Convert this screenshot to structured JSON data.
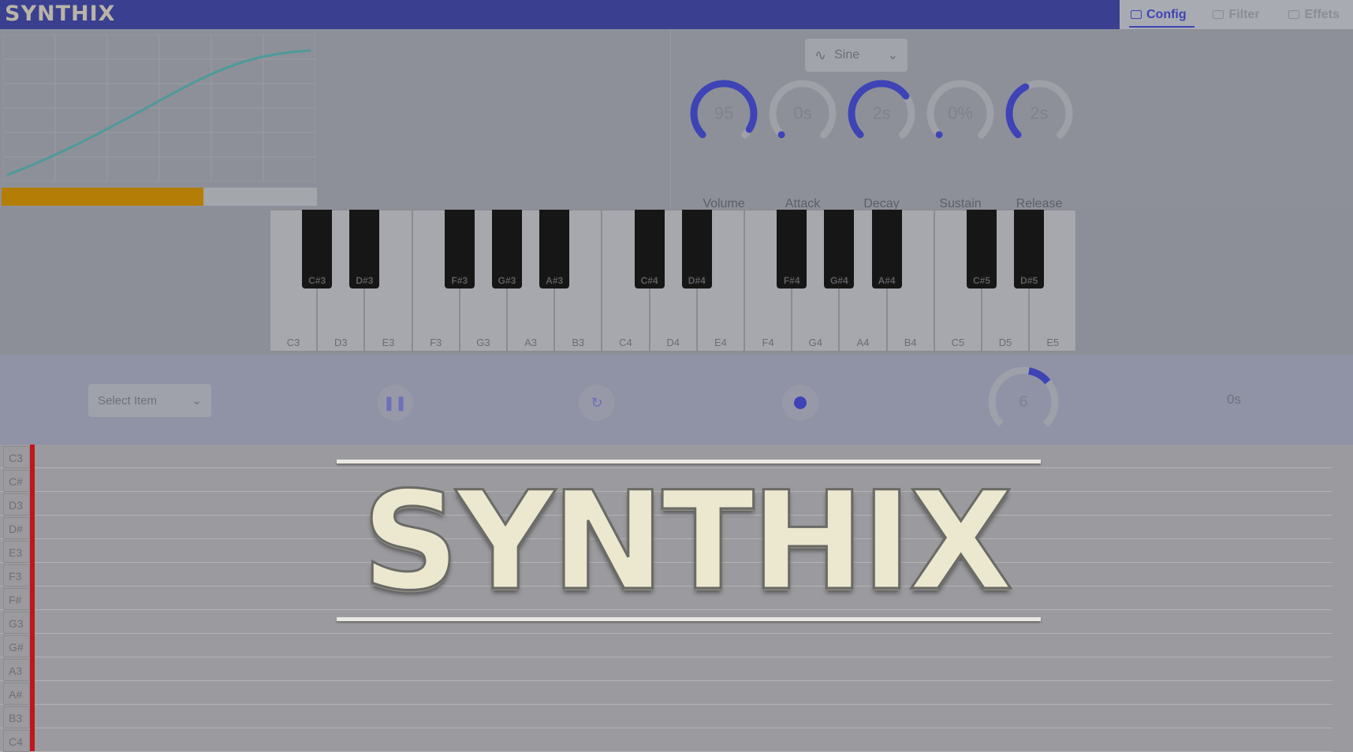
{
  "app": {
    "brand": "SYNTHIX"
  },
  "tabs": [
    {
      "label": "Config",
      "active": true
    },
    {
      "label": "Filter",
      "active": false
    },
    {
      "label": "Effets",
      "active": false
    }
  ],
  "progress": {
    "value": 0.64,
    "color": "#b47d06"
  },
  "waveform": {
    "label": "Sine"
  },
  "knobs": [
    {
      "label": "Volume",
      "value": "95",
      "level": 0.95
    },
    {
      "label": "Attack",
      "value": "0s",
      "level": 0
    },
    {
      "label": "Decay",
      "value": "2s",
      "level": 0.7
    },
    {
      "label": "Sustain",
      "value": "0%",
      "level": 0
    },
    {
      "label": "Release",
      "value": "2s",
      "level": 0.4
    }
  ],
  "keyboard": {
    "white_keys": [
      "C3",
      "D3",
      "E3",
      "F3",
      "G3",
      "A3",
      "B3",
      "C4",
      "D4",
      "E4",
      "F4",
      "G4",
      "A4",
      "B4",
      "C5",
      "D5",
      "E5"
    ],
    "black_keys": [
      "C#3",
      "D#3",
      "F#3",
      "G#3",
      "A#3",
      "C#4",
      "D#4",
      "F#4",
      "G#4",
      "A#4",
      "C#5",
      "D#5"
    ]
  },
  "controls": {
    "select_placeholder": "Select Item",
    "tempo_value": "6",
    "tempo_level": 0.15,
    "time_display": "0s"
  },
  "piano_roll": {
    "rows": [
      "C3",
      "C#",
      "D3",
      "D#",
      "E3",
      "F3",
      "F#",
      "G3",
      "G#",
      "A3",
      "A#",
      "B3",
      "C4"
    ]
  },
  "overlay_logo": {
    "text": "SYNTHIX"
  },
  "colors": {
    "accent": "#3e44b5",
    "topbar": "#3b3f8f",
    "playhead": "#c0161c"
  }
}
